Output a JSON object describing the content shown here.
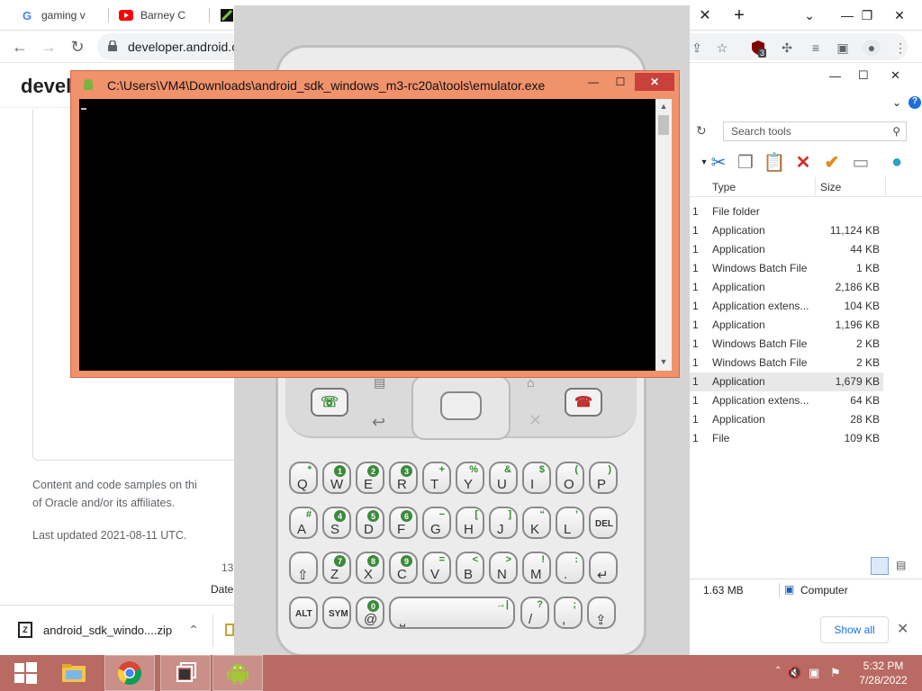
{
  "browser": {
    "tabs": [
      {
        "label": "gaming v",
        "icon": "google-icon"
      },
      {
        "label": "Barney C",
        "icon": "youtube-icon"
      },
      {
        "label": "",
        "icon": "site-icon"
      }
    ],
    "url": "developer.android.c",
    "new_tab": "+",
    "extension_badge": "3"
  },
  "page": {
    "brand": "develo",
    "footer_line1": "Content and code samples on thi",
    "footer_line2": "of Oracle and/or its affiliates.",
    "last_updated": "Last updated 2021-08-11 UTC.",
    "left_num": "13",
    "date_label": "Date"
  },
  "downloads": {
    "file_name": "android_sdk_windo....zip",
    "show_all": "Show all",
    "file_icon_letter": "Z"
  },
  "explorer": {
    "search_placeholder": "Search tools",
    "headers": {
      "type": "Type",
      "size": "Size"
    },
    "rows": [
      {
        "n": "1",
        "type": "File folder",
        "size": ""
      },
      {
        "n": "1",
        "type": "Application",
        "size": "11,124 KB"
      },
      {
        "n": "1",
        "type": "Application",
        "size": "44 KB"
      },
      {
        "n": "1",
        "type": "Windows Batch File",
        "size": "1 KB"
      },
      {
        "n": "1",
        "type": "Application",
        "size": "2,186 KB"
      },
      {
        "n": "1",
        "type": "Application extens...",
        "size": "104 KB"
      },
      {
        "n": "1",
        "type": "Application",
        "size": "1,196 KB"
      },
      {
        "n": "1",
        "type": "Windows Batch File",
        "size": "2 KB"
      },
      {
        "n": "1",
        "type": "Windows Batch File",
        "size": "2 KB"
      },
      {
        "n": "1",
        "type": "Application",
        "size": "1,679 KB",
        "selected": true
      },
      {
        "n": "1",
        "type": "Application extens...",
        "size": "64 KB"
      },
      {
        "n": "1",
        "type": "Application",
        "size": "28 KB"
      },
      {
        "n": "1",
        "type": "File",
        "size": "109 KB"
      }
    ],
    "status_size": "1.63 MB",
    "status_location": "Computer"
  },
  "console": {
    "title": "C:\\Users\\VM4\\Downloads\\android_sdk_windows_m3-rc20a\\tools\\emulator.exe",
    "cursor": "_"
  },
  "keyboard": {
    "row1": [
      {
        "k": "Q",
        "a": "*"
      },
      {
        "k": "W",
        "a": "1"
      },
      {
        "k": "E",
        "a": "2"
      },
      {
        "k": "R",
        "a": "3"
      },
      {
        "k": "T",
        "a": "+"
      },
      {
        "k": "Y",
        "a": "%"
      },
      {
        "k": "U",
        "a": "&"
      },
      {
        "k": "I",
        "a": "$"
      },
      {
        "k": "O",
        "a": "("
      },
      {
        "k": "P",
        "a": ")"
      }
    ],
    "row2": [
      {
        "k": "A",
        "a": "#"
      },
      {
        "k": "S",
        "a": "4"
      },
      {
        "k": "D",
        "a": "5"
      },
      {
        "k": "F",
        "a": "6"
      },
      {
        "k": "G",
        "a": "−"
      },
      {
        "k": "H",
        "a": "["
      },
      {
        "k": "J",
        "a": "]"
      },
      {
        "k": "K",
        "a": "“"
      },
      {
        "k": "L",
        "a": "’"
      },
      {
        "k": "DEL",
        "a": ""
      }
    ],
    "row3": [
      {
        "k": "⇧",
        "a": ""
      },
      {
        "k": "Z",
        "a": "7"
      },
      {
        "k": "X",
        "a": "8"
      },
      {
        "k": "C",
        "a": "9"
      },
      {
        "k": "V",
        "a": "="
      },
      {
        "k": "B",
        "a": "<"
      },
      {
        "k": "N",
        "a": ">"
      },
      {
        "k": "M",
        "a": "!"
      },
      {
        "k": ".",
        "a": ":"
      },
      {
        "k": "↵",
        "a": ""
      }
    ],
    "row4": [
      {
        "k": "ALT",
        "a": ""
      },
      {
        "k": "SYM",
        "a": ""
      },
      {
        "k": "@",
        "a": "0"
      },
      {
        "k": "⎵",
        "a": "→|",
        "wide": true
      },
      {
        "k": "/",
        "a": "?"
      },
      {
        "k": ",",
        "a": ";"
      },
      {
        "k": "⇪",
        "a": ""
      }
    ]
  },
  "taskbar": {
    "time": "5:32 PM",
    "date": "7/28/2022"
  }
}
